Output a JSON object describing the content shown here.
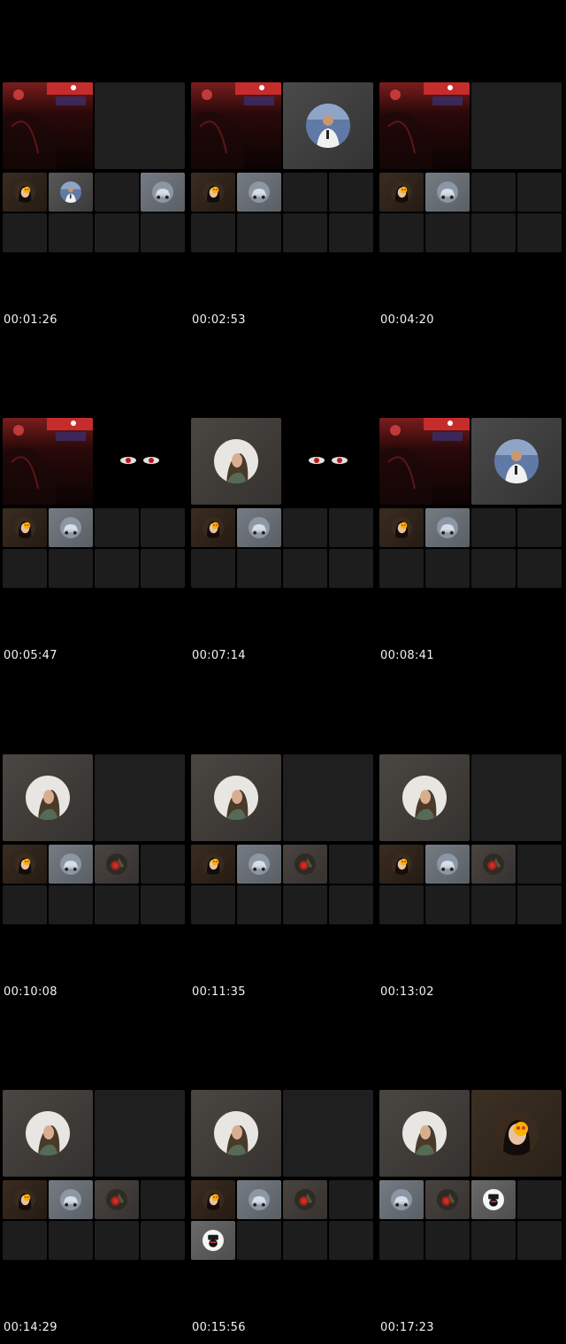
{
  "thumbnails": [
    {
      "timestamp": "00:01:26",
      "big": [
        "concert",
        "empty"
      ],
      "small": [
        "woman-emoji",
        "man-white-shirt",
        "empty",
        "car",
        "empty",
        "empty",
        "empty",
        "empty"
      ]
    },
    {
      "timestamp": "00:02:53",
      "big": [
        "concert",
        "man-white-shirt"
      ],
      "small": [
        "woman-emoji",
        "car",
        "empty",
        "empty",
        "empty",
        "empty",
        "empty",
        "empty"
      ]
    },
    {
      "timestamp": "00:04:20",
      "big": [
        "concert",
        "empty"
      ],
      "small": [
        "woman-emoji",
        "car",
        "empty",
        "empty",
        "empty",
        "empty",
        "empty",
        "empty"
      ]
    },
    {
      "timestamp": "00:05:47",
      "big": [
        "concert",
        "red-eyes"
      ],
      "small": [
        "woman-emoji",
        "car",
        "empty",
        "empty",
        "empty",
        "empty",
        "empty",
        "empty"
      ]
    },
    {
      "timestamp": "00:07:14",
      "big": [
        "woman-selfie",
        "red-eyes"
      ],
      "small": [
        "woman-emoji",
        "car",
        "empty",
        "empty",
        "empty",
        "empty",
        "empty",
        "empty"
      ]
    },
    {
      "timestamp": "00:08:41",
      "big": [
        "concert",
        "man-white-shirt"
      ],
      "small": [
        "woman-emoji",
        "car",
        "empty",
        "empty",
        "empty",
        "empty",
        "empty",
        "empty"
      ]
    },
    {
      "timestamp": "00:10:08",
      "big": [
        "woman-selfie",
        "empty"
      ],
      "small": [
        "woman-emoji",
        "car",
        "rose",
        "empty",
        "empty",
        "empty",
        "empty",
        "empty"
      ]
    },
    {
      "timestamp": "00:11:35",
      "big": [
        "woman-selfie",
        "empty"
      ],
      "small": [
        "woman-emoji",
        "car",
        "rose",
        "empty",
        "empty",
        "empty",
        "empty",
        "empty"
      ]
    },
    {
      "timestamp": "00:13:02",
      "big": [
        "woman-selfie",
        "empty"
      ],
      "small": [
        "woman-emoji",
        "car",
        "rose",
        "empty",
        "empty",
        "empty",
        "empty",
        "empty"
      ]
    },
    {
      "timestamp": "00:14:29",
      "big": [
        "woman-selfie",
        "empty"
      ],
      "small": [
        "woman-emoji",
        "car",
        "rose",
        "empty",
        "empty",
        "empty",
        "empty",
        "empty"
      ]
    },
    {
      "timestamp": "00:15:56",
      "big": [
        "woman-selfie",
        "empty"
      ],
      "small": [
        "woman-emoji",
        "car",
        "rose",
        "empty",
        "white-mask",
        "empty",
        "empty",
        "empty"
      ]
    },
    {
      "timestamp": "00:17:23",
      "big": [
        "woman-selfie",
        "woman-emoji"
      ],
      "small": [
        "car",
        "rose",
        "white-mask",
        "empty",
        "empty",
        "empty",
        "empty",
        "empty"
      ]
    }
  ]
}
